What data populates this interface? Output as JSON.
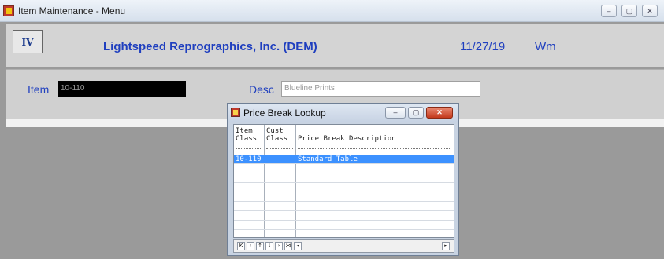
{
  "window": {
    "title": "Item Maintenance - Menu"
  },
  "header": {
    "logo_text": "IV",
    "company": "Lightspeed Reprographics, Inc. (DEM)",
    "date": "11/27/19",
    "user": "Wm"
  },
  "form": {
    "item_label": "Item",
    "item_value": "10-110",
    "desc_label": "Desc",
    "desc_value": "Blueline Prints"
  },
  "dialog": {
    "title": "Price Break Lookup",
    "columns": [
      {
        "line1": "Item",
        "line2": "Class"
      },
      {
        "line1": "Cust",
        "line2": "Class"
      },
      {
        "line1": "",
        "line2": "Price Break Description"
      }
    ],
    "rows": [
      {
        "item_class": "10-110",
        "cust_class": "",
        "description": "Standard Table",
        "selected": true
      }
    ],
    "empty_rows": 8,
    "nav_buttons": [
      {
        "name": "first-record-icon",
        "glyph": "K"
      },
      {
        "name": "previous-page-icon",
        "glyph": "‹"
      },
      {
        "name": "previous-record-icon",
        "glyph": "↑"
      },
      {
        "name": "next-record-icon",
        "glyph": "↓"
      },
      {
        "name": "next-page-icon",
        "glyph": "›"
      },
      {
        "name": "last-record-icon",
        "glyph": "⋊"
      },
      {
        "name": "scroll-left-icon",
        "glyph": "◂"
      },
      {
        "name": "scroll-right-icon",
        "glyph": "▸"
      }
    ]
  }
}
